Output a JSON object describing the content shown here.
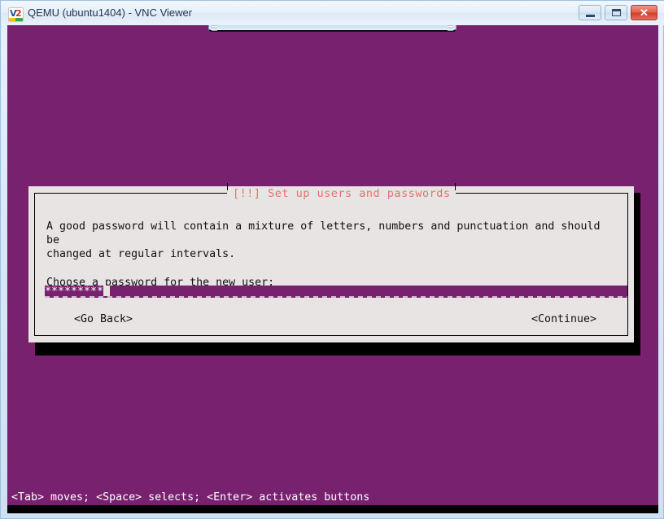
{
  "window": {
    "title": "QEMU (ubuntu1404) - VNC Viewer",
    "icon": "vnc-viewer-icon",
    "controls": {
      "minimize_label": "—",
      "maximize_label": "□",
      "close_label": "✕"
    },
    "frame_color": "#cfe0f2"
  },
  "screen": {
    "background_color": "#77216f",
    "toolbar_tab": "vnc-toolbar-tab"
  },
  "dialog": {
    "title": "[!!] Set up users and passwords",
    "title_color": "#e76f6f",
    "background_color": "#e8e4e4",
    "paragraph": "A good password will contain a mixture of letters, numbers and punctuation and should be\nchanged at regular intervals.",
    "prompt": "Choose a password for the new user:",
    "password_field": {
      "masked_value": "*********",
      "mask_char": "*",
      "length": 9,
      "field_color": "#77216f",
      "cursor_visible": true
    },
    "buttons": {
      "go_back": "<Go Back>",
      "continue": "<Continue>"
    }
  },
  "statusbar": {
    "text": "<Tab> moves; <Space> selects; <Enter> activates buttons",
    "background_color": "#77216f",
    "text_color": "#ffffff"
  }
}
